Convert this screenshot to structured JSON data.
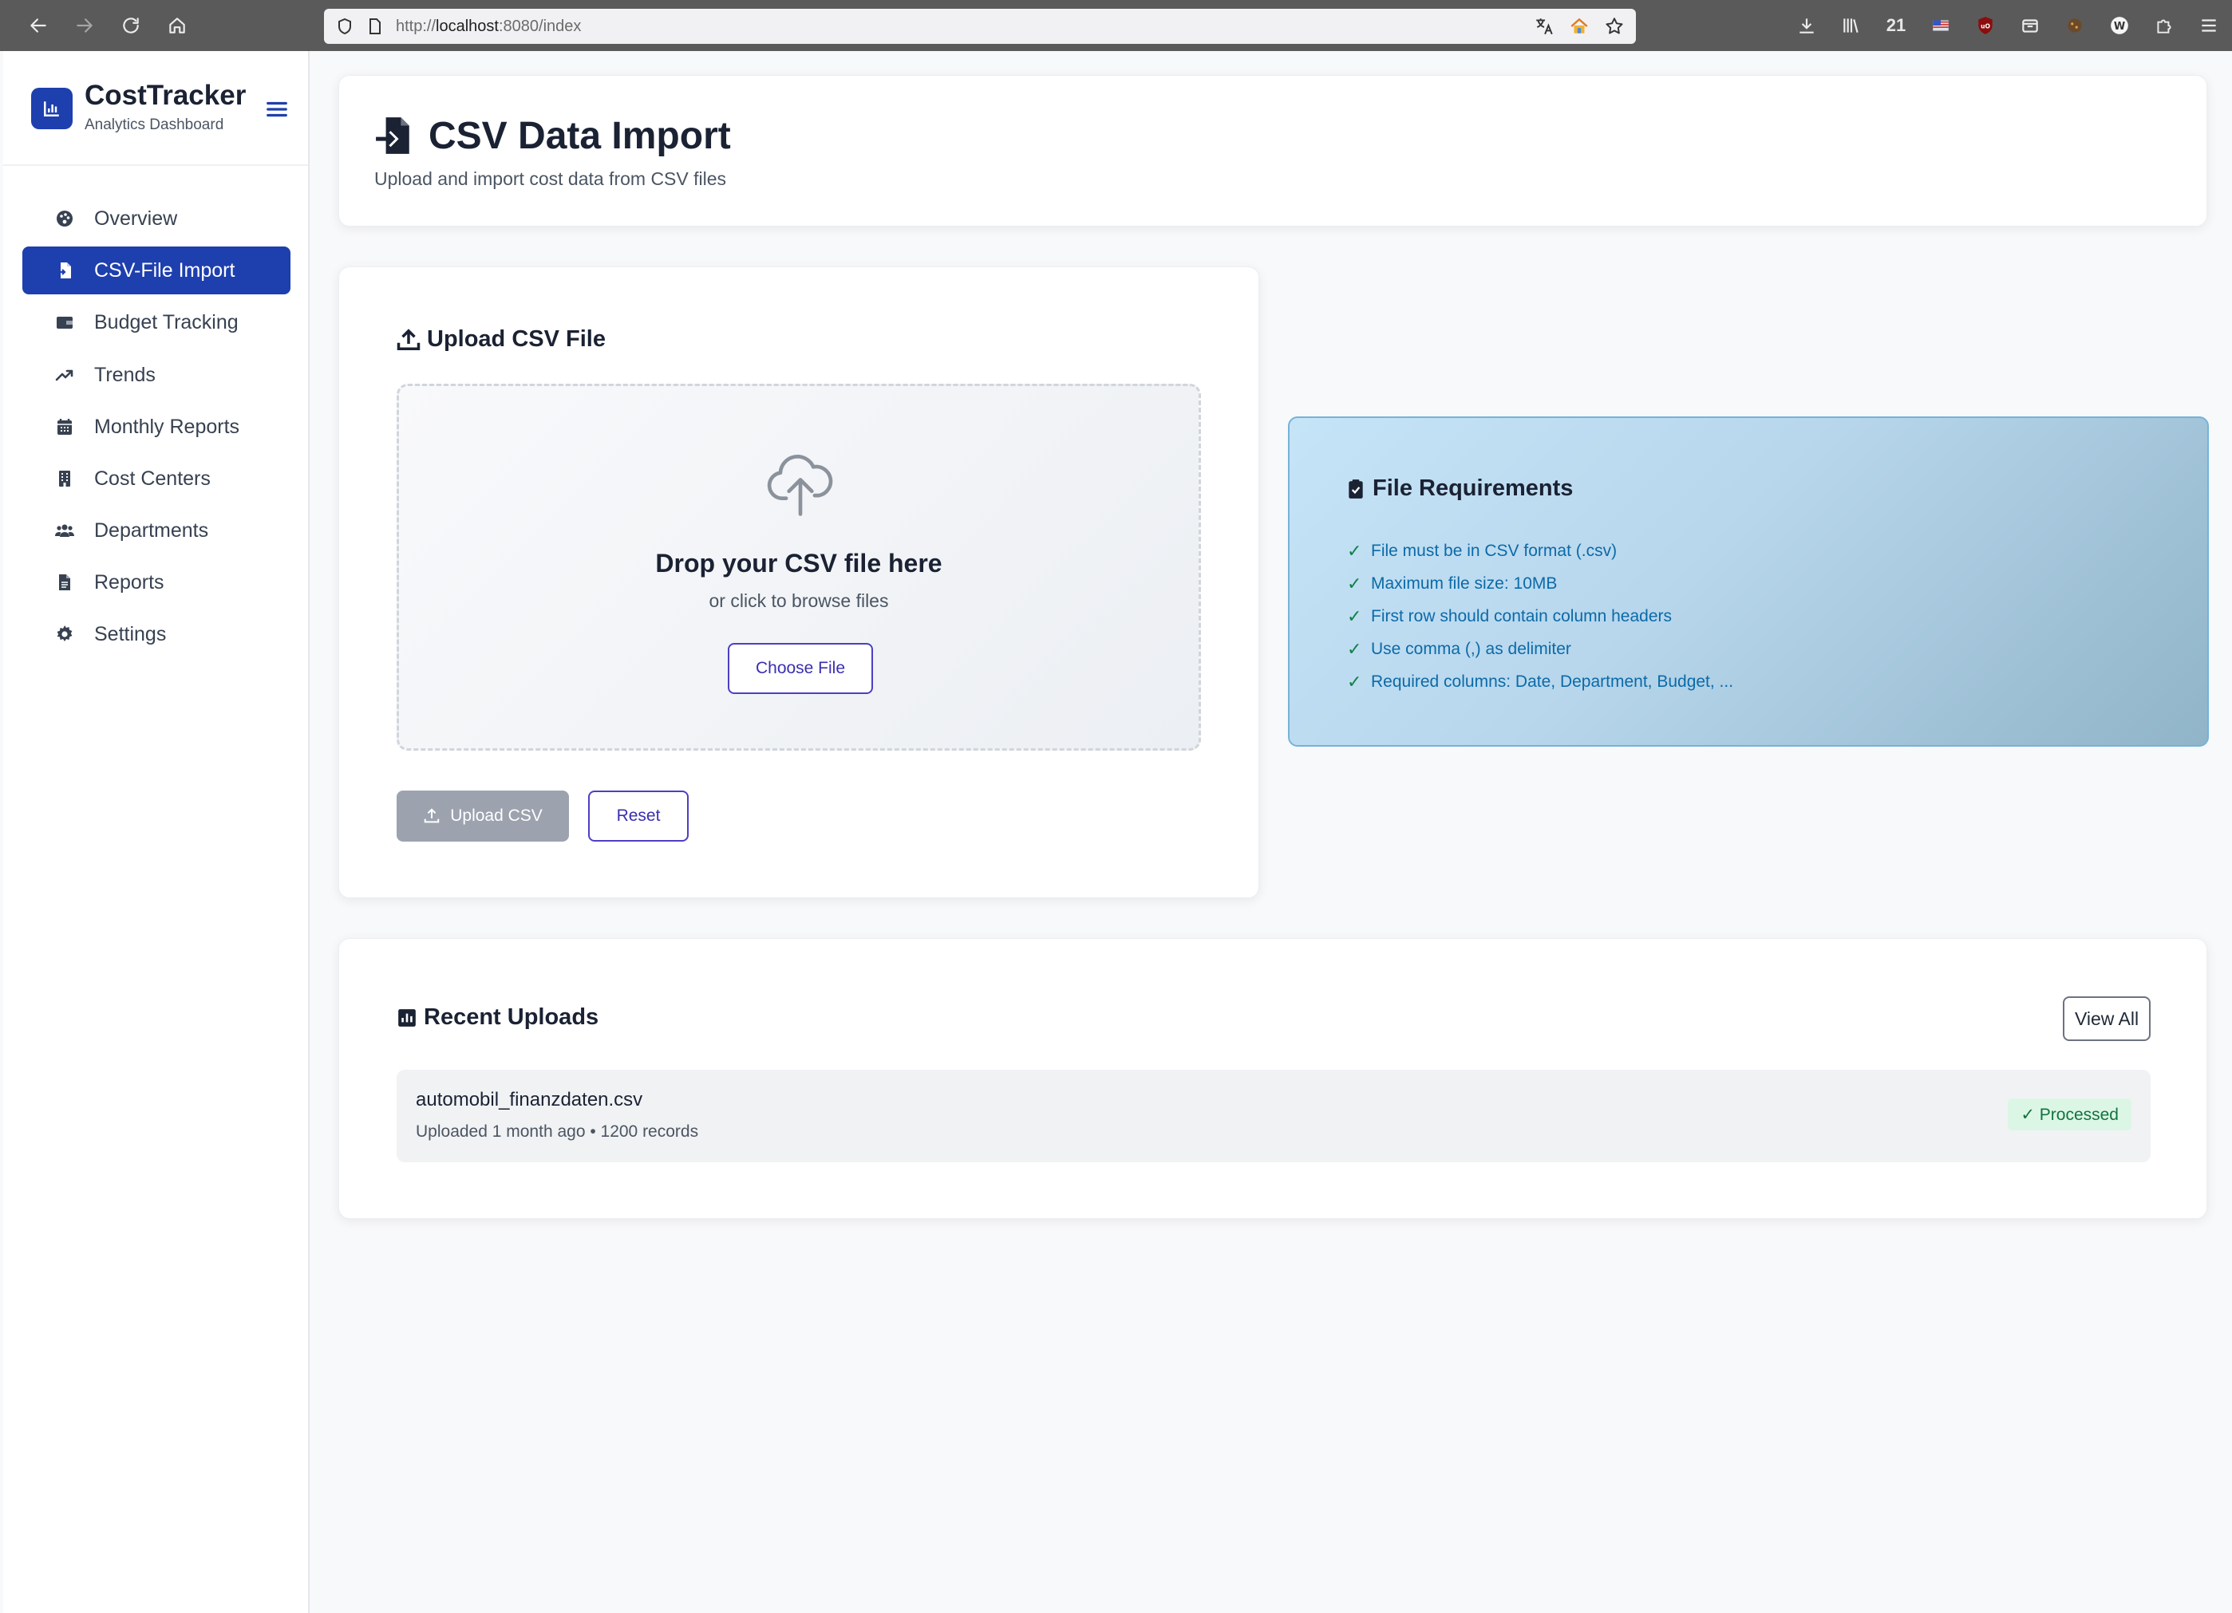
{
  "browser": {
    "url_prefix": "http://",
    "url_host": "localhost",
    "url_rest": ":8080/index",
    "badge_count": "21"
  },
  "sidebar": {
    "brand_title": "CostTracker",
    "brand_subtitle": "Analytics Dashboard",
    "items": [
      {
        "label": "Overview",
        "icon": "palette-icon"
      },
      {
        "label": "CSV-File Import",
        "icon": "file-import-icon",
        "active": true
      },
      {
        "label": "Budget Tracking",
        "icon": "wallet-icon"
      },
      {
        "label": "Trends",
        "icon": "trend-up-icon"
      },
      {
        "label": "Monthly Reports",
        "icon": "calendar-icon"
      },
      {
        "label": "Cost Centers",
        "icon": "building-icon"
      },
      {
        "label": "Departments",
        "icon": "users-icon"
      },
      {
        "label": "Reports",
        "icon": "file-text-icon"
      },
      {
        "label": "Settings",
        "icon": "gear-icon"
      }
    ]
  },
  "header": {
    "title": "CSV Data Import",
    "subtitle": "Upload and import cost data from CSV files"
  },
  "upload": {
    "title": "Upload CSV File",
    "drop_title": "Drop your CSV file here",
    "drop_subtitle": "or click to browse files",
    "choose_label": "Choose File",
    "upload_label": "Upload CSV",
    "reset_label": "Reset"
  },
  "requirements": {
    "title": "File Requirements",
    "items": [
      "File must be in CSV format (.csv)",
      "Maximum file size: 10MB",
      "First row should contain column headers",
      "Use comma (,) as delimiter",
      "Required columns: Date, Department, Budget, ..."
    ]
  },
  "recent": {
    "title": "Recent Uploads",
    "view_all_label": "View All",
    "uploads": [
      {
        "file_name": "automobil_finanzdaten.csv",
        "meta": "Uploaded 1 month ago • 1200 records",
        "status": "✓ Processed"
      }
    ]
  },
  "colors": {
    "primary": "#1e3fae",
    "accent_outline": "#4c3fc4",
    "success": "#12733f",
    "info": "#0b6aa8"
  }
}
